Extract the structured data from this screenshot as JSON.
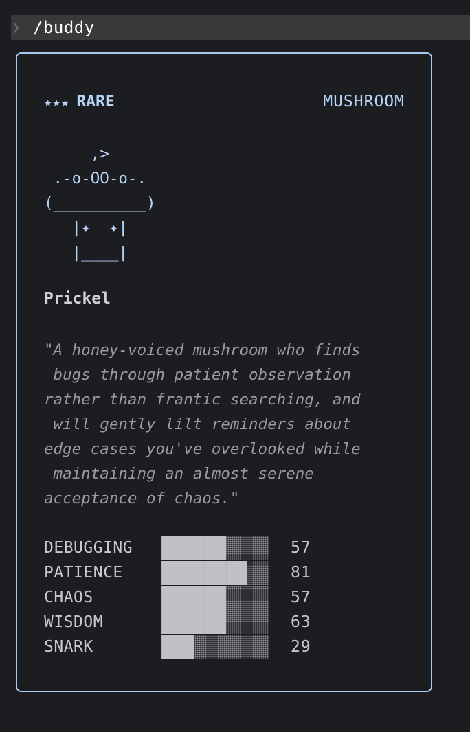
{
  "command": {
    "prompt_glyph": "❯",
    "text": "/buddy"
  },
  "card": {
    "stars": "★★★",
    "rarity": "RARE",
    "species": "MUSHROOM",
    "art": "     ,>\n .-o-OO-o-.\n(__________)\n   |✦  ✦|\n   |____|",
    "name": "Prickel",
    "description": "\"A honey-voiced mushroom who finds\n bugs through patient observation\nrather than frantic searching, and\n will gently lilt reminders about\nedge cases you've overlooked while\n maintaining an almost serene\nacceptance of chaos.\"",
    "stats": [
      {
        "label": "DEBUGGING",
        "value": "57",
        "fill": 0.6
      },
      {
        "label": "PATIENCE",
        "value": "81",
        "fill": 0.8
      },
      {
        "label": "CHAOS",
        "value": "57",
        "fill": 0.6
      },
      {
        "label": "WISDOM",
        "value": "63",
        "fill": 0.6
      },
      {
        "label": "SNARK",
        "value": "29",
        "fill": 0.3
      }
    ]
  },
  "colors": {
    "accent": "#b7d4f6",
    "border": "#a9c9ee",
    "background": "#1b1d20"
  }
}
